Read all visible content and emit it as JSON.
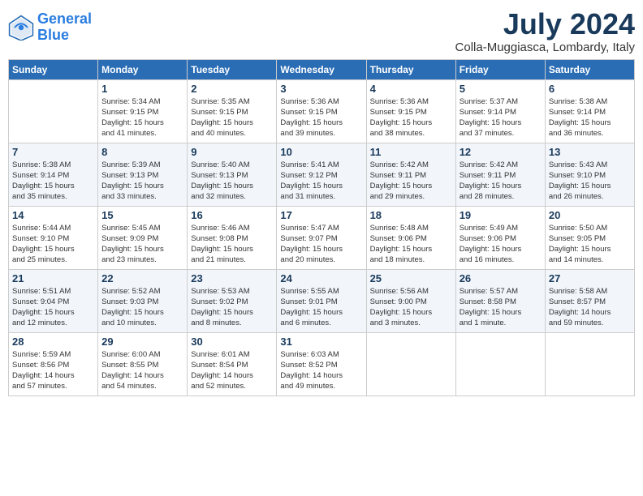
{
  "header": {
    "logo_line1": "General",
    "logo_line2": "Blue",
    "month_year": "July 2024",
    "location": "Colla-Muggiasca, Lombardy, Italy"
  },
  "days_of_week": [
    "Sunday",
    "Monday",
    "Tuesday",
    "Wednesday",
    "Thursday",
    "Friday",
    "Saturday"
  ],
  "weeks": [
    [
      {
        "day": "",
        "info": ""
      },
      {
        "day": "1",
        "info": "Sunrise: 5:34 AM\nSunset: 9:15 PM\nDaylight: 15 hours\nand 41 minutes."
      },
      {
        "day": "2",
        "info": "Sunrise: 5:35 AM\nSunset: 9:15 PM\nDaylight: 15 hours\nand 40 minutes."
      },
      {
        "day": "3",
        "info": "Sunrise: 5:36 AM\nSunset: 9:15 PM\nDaylight: 15 hours\nand 39 minutes."
      },
      {
        "day": "4",
        "info": "Sunrise: 5:36 AM\nSunset: 9:15 PM\nDaylight: 15 hours\nand 38 minutes."
      },
      {
        "day": "5",
        "info": "Sunrise: 5:37 AM\nSunset: 9:14 PM\nDaylight: 15 hours\nand 37 minutes."
      },
      {
        "day": "6",
        "info": "Sunrise: 5:38 AM\nSunset: 9:14 PM\nDaylight: 15 hours\nand 36 minutes."
      }
    ],
    [
      {
        "day": "7",
        "info": "Sunrise: 5:38 AM\nSunset: 9:14 PM\nDaylight: 15 hours\nand 35 minutes."
      },
      {
        "day": "8",
        "info": "Sunrise: 5:39 AM\nSunset: 9:13 PM\nDaylight: 15 hours\nand 33 minutes."
      },
      {
        "day": "9",
        "info": "Sunrise: 5:40 AM\nSunset: 9:13 PM\nDaylight: 15 hours\nand 32 minutes."
      },
      {
        "day": "10",
        "info": "Sunrise: 5:41 AM\nSunset: 9:12 PM\nDaylight: 15 hours\nand 31 minutes."
      },
      {
        "day": "11",
        "info": "Sunrise: 5:42 AM\nSunset: 9:11 PM\nDaylight: 15 hours\nand 29 minutes."
      },
      {
        "day": "12",
        "info": "Sunrise: 5:42 AM\nSunset: 9:11 PM\nDaylight: 15 hours\nand 28 minutes."
      },
      {
        "day": "13",
        "info": "Sunrise: 5:43 AM\nSunset: 9:10 PM\nDaylight: 15 hours\nand 26 minutes."
      }
    ],
    [
      {
        "day": "14",
        "info": "Sunrise: 5:44 AM\nSunset: 9:10 PM\nDaylight: 15 hours\nand 25 minutes."
      },
      {
        "day": "15",
        "info": "Sunrise: 5:45 AM\nSunset: 9:09 PM\nDaylight: 15 hours\nand 23 minutes."
      },
      {
        "day": "16",
        "info": "Sunrise: 5:46 AM\nSunset: 9:08 PM\nDaylight: 15 hours\nand 21 minutes."
      },
      {
        "day": "17",
        "info": "Sunrise: 5:47 AM\nSunset: 9:07 PM\nDaylight: 15 hours\nand 20 minutes."
      },
      {
        "day": "18",
        "info": "Sunrise: 5:48 AM\nSunset: 9:06 PM\nDaylight: 15 hours\nand 18 minutes."
      },
      {
        "day": "19",
        "info": "Sunrise: 5:49 AM\nSunset: 9:06 PM\nDaylight: 15 hours\nand 16 minutes."
      },
      {
        "day": "20",
        "info": "Sunrise: 5:50 AM\nSunset: 9:05 PM\nDaylight: 15 hours\nand 14 minutes."
      }
    ],
    [
      {
        "day": "21",
        "info": "Sunrise: 5:51 AM\nSunset: 9:04 PM\nDaylight: 15 hours\nand 12 minutes."
      },
      {
        "day": "22",
        "info": "Sunrise: 5:52 AM\nSunset: 9:03 PM\nDaylight: 15 hours\nand 10 minutes."
      },
      {
        "day": "23",
        "info": "Sunrise: 5:53 AM\nSunset: 9:02 PM\nDaylight: 15 hours\nand 8 minutes."
      },
      {
        "day": "24",
        "info": "Sunrise: 5:55 AM\nSunset: 9:01 PM\nDaylight: 15 hours\nand 6 minutes."
      },
      {
        "day": "25",
        "info": "Sunrise: 5:56 AM\nSunset: 9:00 PM\nDaylight: 15 hours\nand 3 minutes."
      },
      {
        "day": "26",
        "info": "Sunrise: 5:57 AM\nSunset: 8:58 PM\nDaylight: 15 hours\nand 1 minute."
      },
      {
        "day": "27",
        "info": "Sunrise: 5:58 AM\nSunset: 8:57 PM\nDaylight: 14 hours\nand 59 minutes."
      }
    ],
    [
      {
        "day": "28",
        "info": "Sunrise: 5:59 AM\nSunset: 8:56 PM\nDaylight: 14 hours\nand 57 minutes."
      },
      {
        "day": "29",
        "info": "Sunrise: 6:00 AM\nSunset: 8:55 PM\nDaylight: 14 hours\nand 54 minutes."
      },
      {
        "day": "30",
        "info": "Sunrise: 6:01 AM\nSunset: 8:54 PM\nDaylight: 14 hours\nand 52 minutes."
      },
      {
        "day": "31",
        "info": "Sunrise: 6:03 AM\nSunset: 8:52 PM\nDaylight: 14 hours\nand 49 minutes."
      },
      {
        "day": "",
        "info": ""
      },
      {
        "day": "",
        "info": ""
      },
      {
        "day": "",
        "info": ""
      }
    ]
  ]
}
